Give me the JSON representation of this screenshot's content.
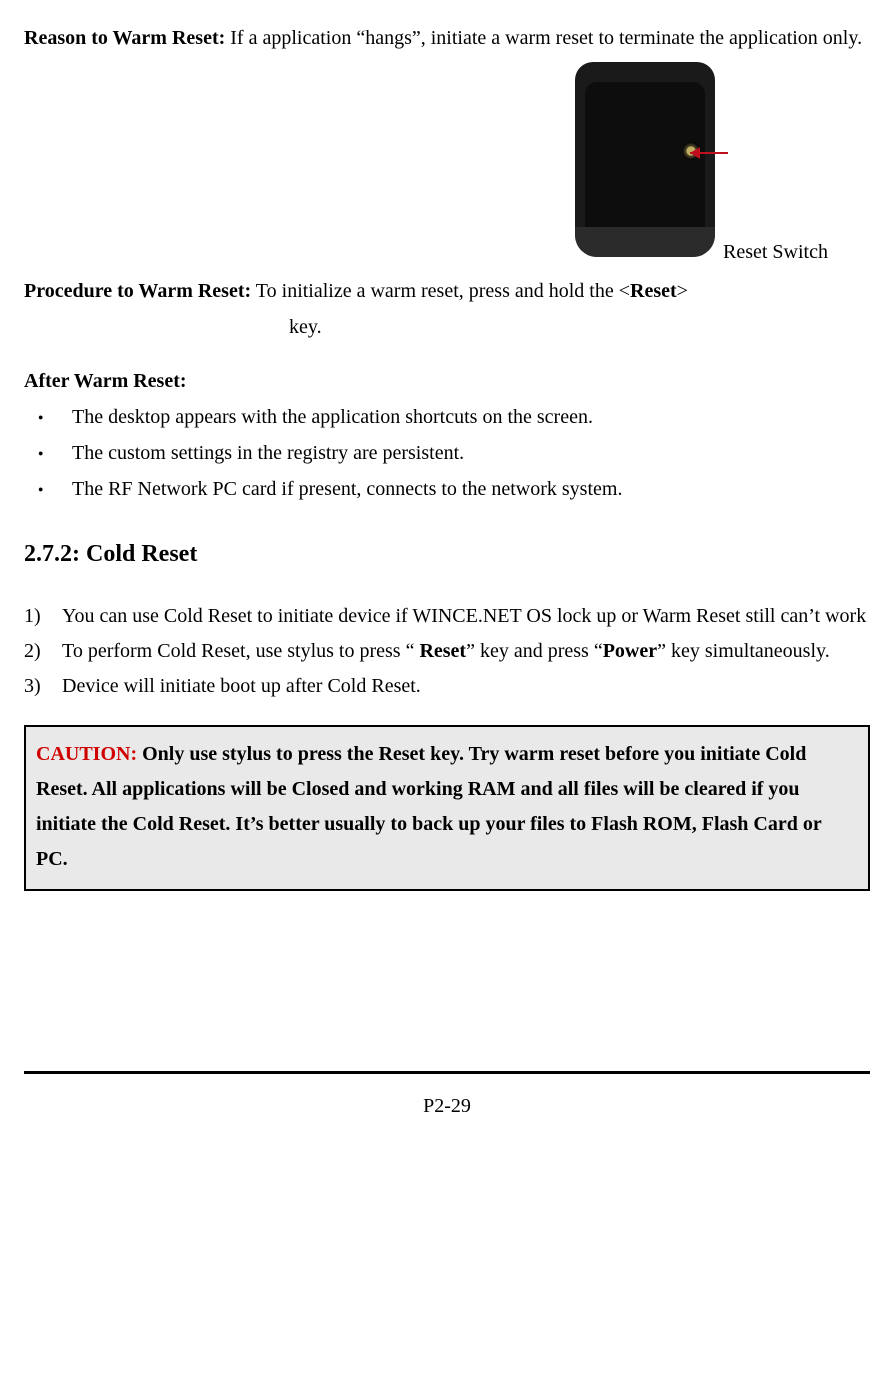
{
  "warm_reset": {
    "reason_label": "Reason to Warm Reset:",
    "reason_text": " If a application “hangs”, initiate a warm reset to terminate the application only.",
    "figure_label": "Reset Switch",
    "procedure_label": "Procedure to Warm Reset:",
    "procedure_text_pre": " To initialize a warm reset, press and hold the <",
    "procedure_bold": "Reset",
    "procedure_text_post": "> key.",
    "after_label": "After Warm Reset:",
    "bullets": [
      "The desktop appears with the application shortcuts on the screen.",
      "The custom settings in the registry are persistent.",
      "The RF Network PC card if present, connects to the network system."
    ]
  },
  "cold_reset": {
    "heading": "2.7.2: Cold Reset",
    "items": [
      {
        "num": "1)",
        "segments": [
          {
            "t": "You can use Cold Reset to initiate device if WINCE.NET OS lock up or Warm Reset still can’t work"
          }
        ]
      },
      {
        "num": "2)",
        "segments": [
          {
            "t": "To perform Cold Reset, use stylus to press “ "
          },
          {
            "t": "Reset",
            "b": true
          },
          {
            "t": "” key and press “"
          },
          {
            "t": "Power",
            "b": true
          },
          {
            "t": "” key simultaneously."
          }
        ]
      },
      {
        "num": "3)",
        "segments": [
          {
            "t": "Device will initiate boot up after Cold Reset."
          }
        ]
      }
    ]
  },
  "caution": {
    "label": "CAUTION:",
    "text": " Only use stylus to press the Reset key. Try warm reset before you initiate Cold Reset. All applications will be Closed and working RAM and all files will be cleared if you initiate the Cold Reset. It’s better usually to back up your files to Flash ROM, Flash Card or PC."
  },
  "page_number": "P2-29"
}
